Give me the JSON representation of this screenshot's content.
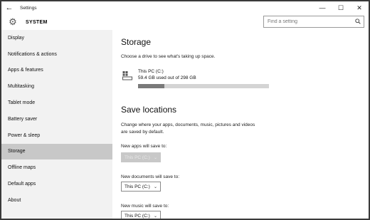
{
  "window": {
    "title": "Settings",
    "back_icon": "back-arrow-icon",
    "controls": {
      "minimize": "—",
      "maximize": "☐",
      "close": "✕"
    }
  },
  "header": {
    "section": "SYSTEM",
    "icon": "gear-icon",
    "search_placeholder": "Find a setting"
  },
  "sidebar": {
    "items": [
      {
        "label": "Display"
      },
      {
        "label": "Notifications & actions"
      },
      {
        "label": "Apps & features"
      },
      {
        "label": "Multitasking"
      },
      {
        "label": "Tablet mode"
      },
      {
        "label": "Battery saver"
      },
      {
        "label": "Power & sleep"
      },
      {
        "label": "Storage",
        "active": true
      },
      {
        "label": "Offline maps"
      },
      {
        "label": "Default apps"
      },
      {
        "label": "About"
      }
    ]
  },
  "storage": {
    "title": "Storage",
    "subtitle": "Choose a drive to see what's taking up space.",
    "drive": {
      "name": "This PC (C:)",
      "usage": "59.4 GB used out of 298 GB",
      "used_fraction": 0.199
    }
  },
  "save_locations": {
    "title": "Save locations",
    "description_line1": "Change where your apps, documents, music, pictures and videos",
    "description_line2": "are saved by default.",
    "apps": {
      "label": "New apps will save to:",
      "value": "This PC (C:)",
      "disabled": true
    },
    "documents": {
      "label": "New documents will save to:",
      "value": "This PC (C:)"
    },
    "music": {
      "label": "New music will save to:",
      "value": "This PC (C:)"
    }
  },
  "colors": {
    "sidebar_bg": "#f2f2f2",
    "active_item_bg": "#c8c8c8",
    "bar_fill": "#7a7a7a",
    "bar_track": "#d4d4d4"
  }
}
